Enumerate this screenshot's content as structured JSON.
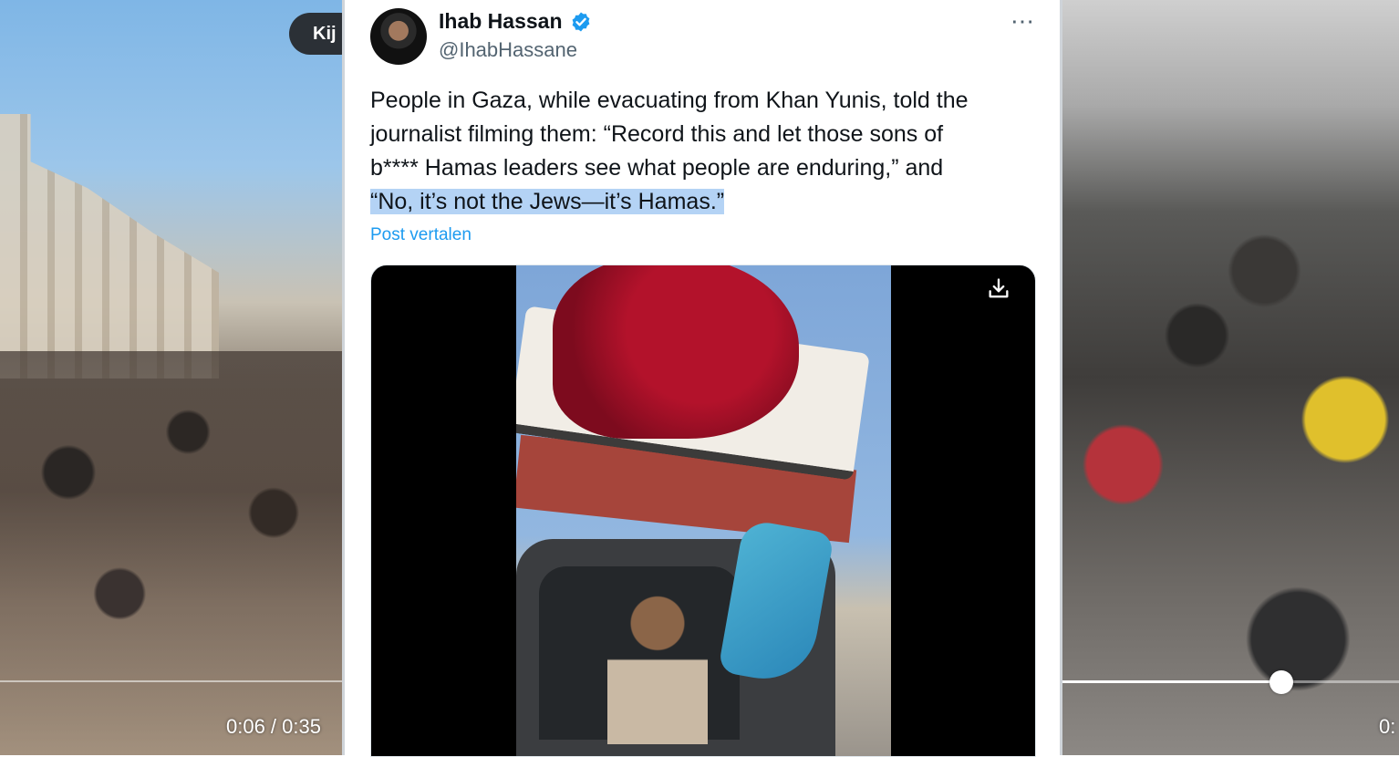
{
  "left_video": {
    "watch_label": "Kij",
    "time": "0:06 / 0:35"
  },
  "tweet": {
    "author": {
      "name": "Ihab Hassan",
      "handle": "@IhabHassane",
      "verified": true
    },
    "text_lines": [
      "People in Gaza, while evacuating from Khan Yunis, told the",
      "journalist filming them: “Record this and let those sons of",
      "b**** Hamas leaders see what people are enduring,” and"
    ],
    "highlighted_line": "“No, it’s not the Jews—it’s Hamas.”",
    "translate_label": "Post vertalen"
  },
  "right_video": {
    "time": "0:",
    "progress": 0.65
  },
  "colors": {
    "link": "#1d9bf0",
    "verified": "#1d9bf0",
    "highlight": "#b4d3f5",
    "pill_bg": "#2b3036"
  },
  "icons": [
    "verified-badge-icon",
    "more-options-icon",
    "download-icon"
  ]
}
